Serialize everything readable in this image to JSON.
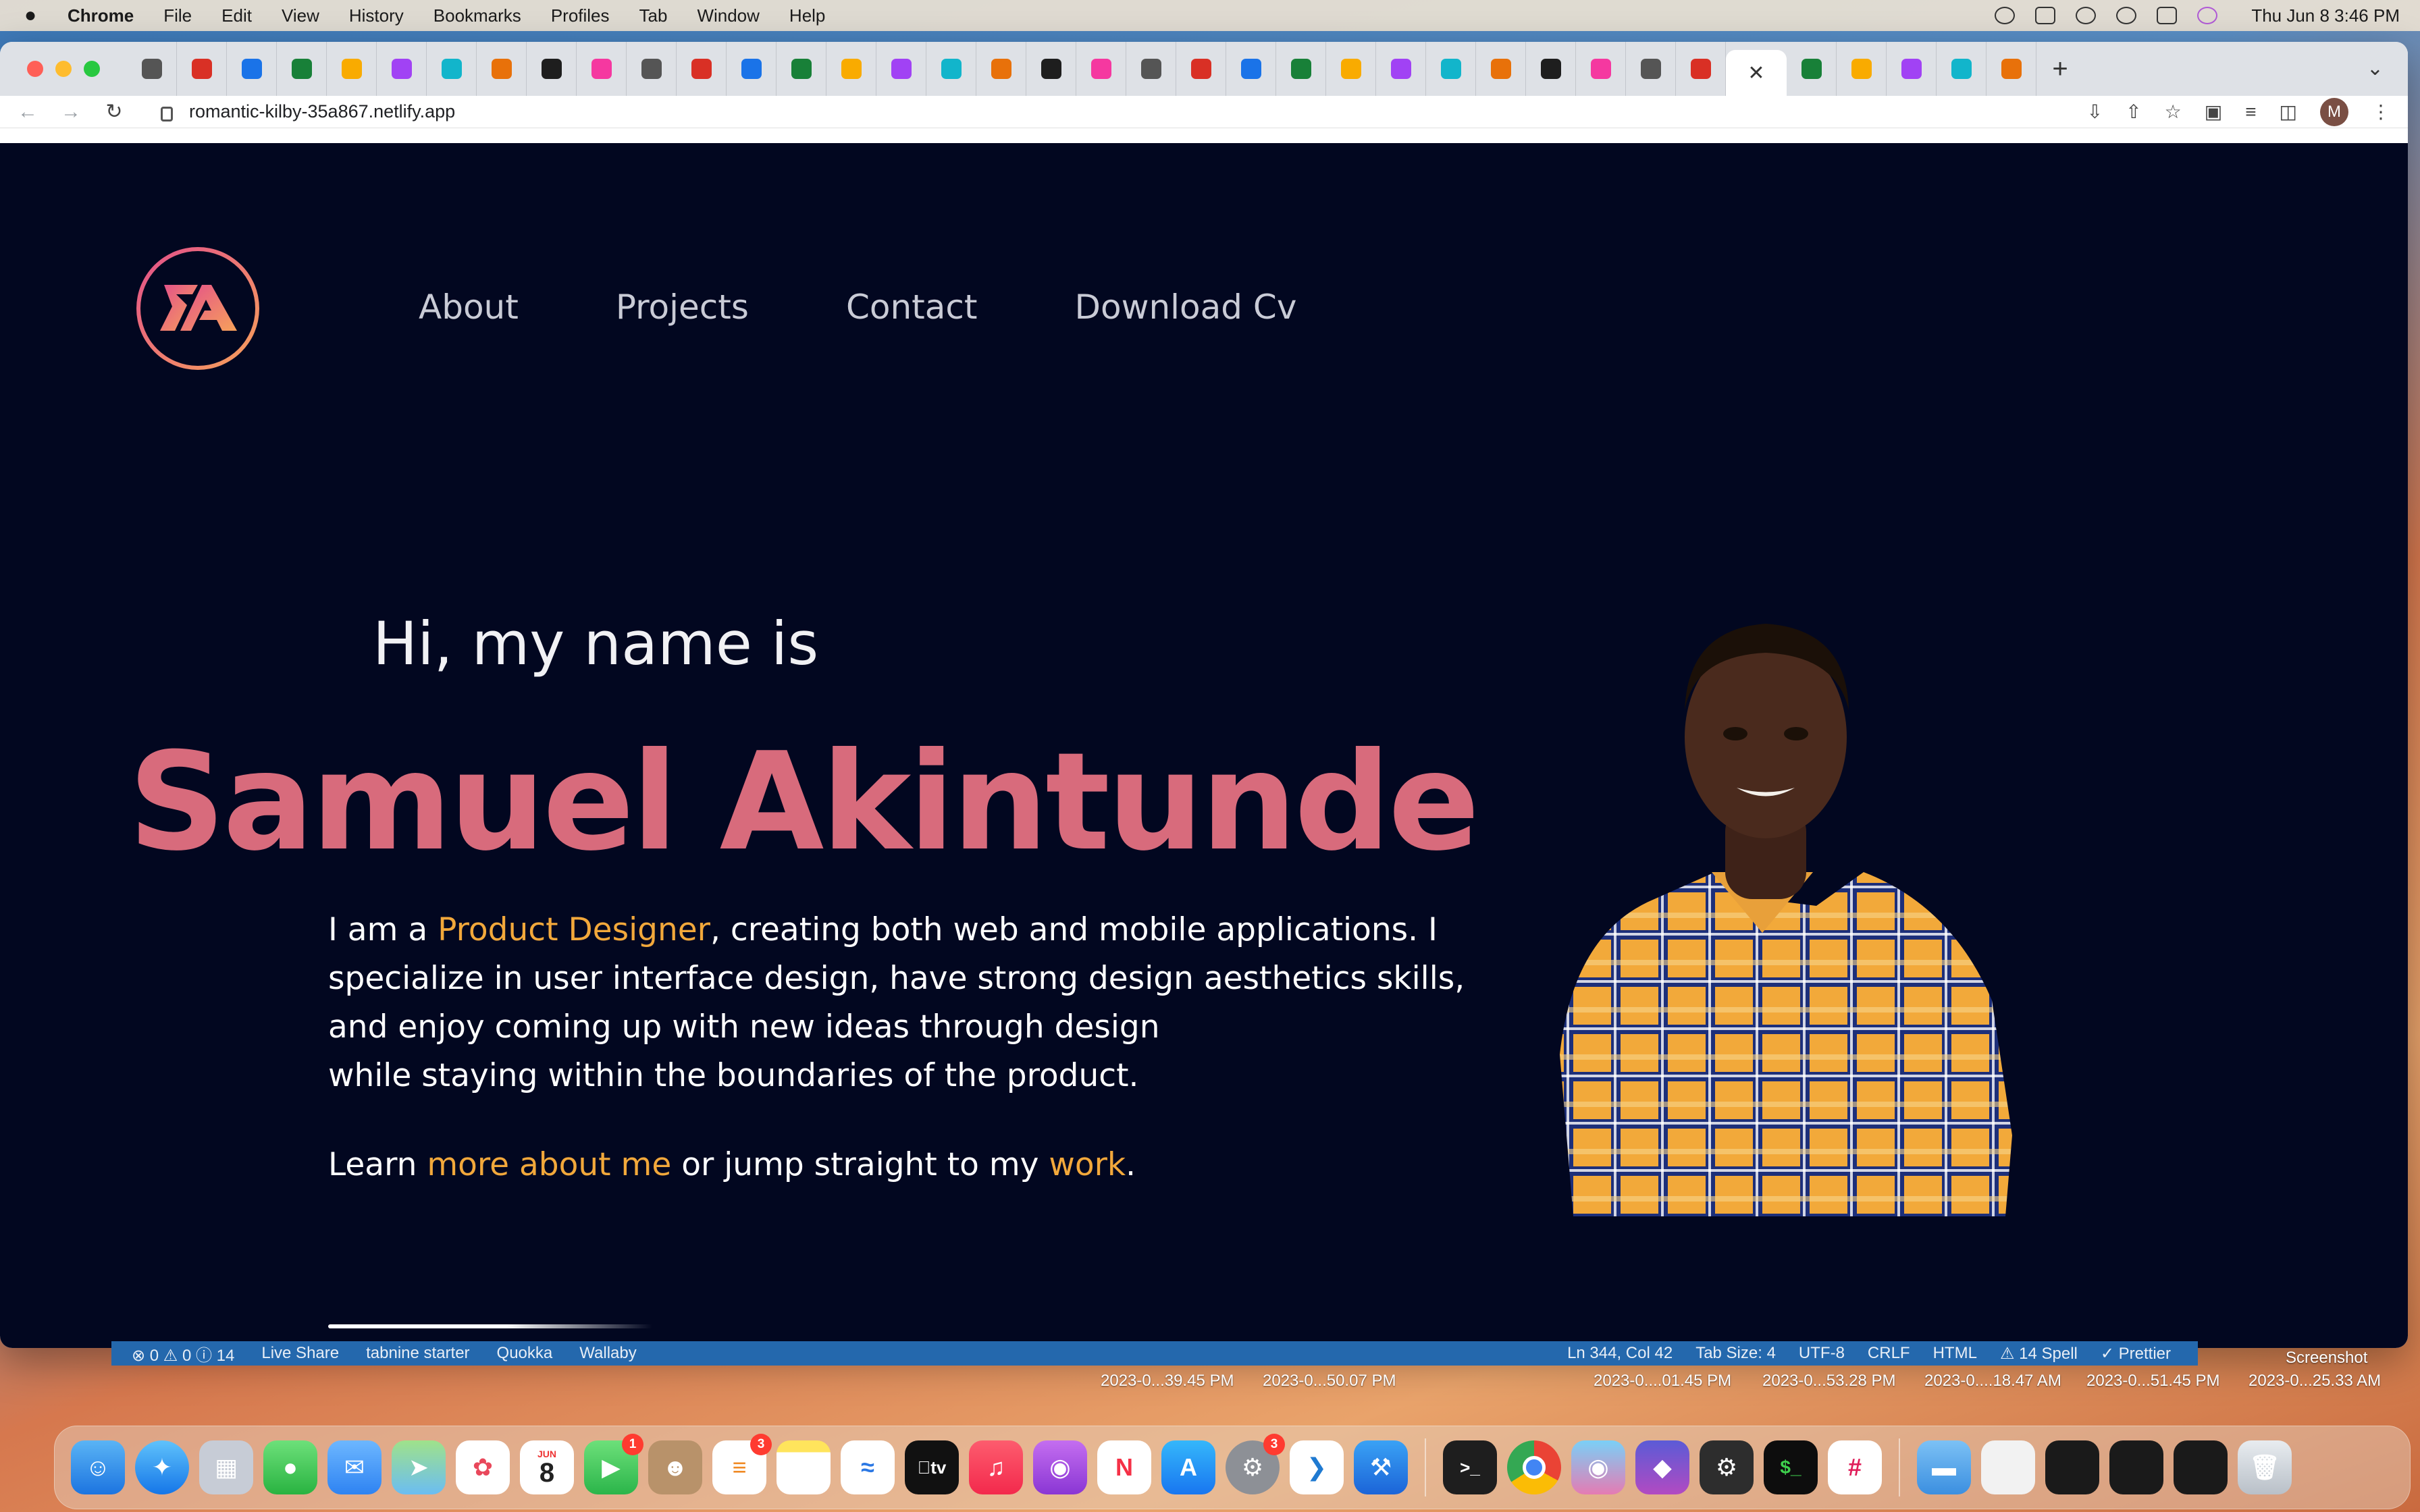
{
  "menubar": {
    "app_name": "Chrome",
    "menus": [
      "File",
      "Edit",
      "View",
      "History",
      "Bookmarks",
      "Profiles",
      "Tab",
      "Window",
      "Help"
    ],
    "clock": "Thu Jun 8  3:46 PM"
  },
  "browser": {
    "url": "romantic-kilby-35a867.netlify.app",
    "profile_initial": "M",
    "tab_count_visible": 37
  },
  "site": {
    "nav": [
      "About",
      "Projects",
      "Contact",
      "Download Cv"
    ],
    "greeting": "Hi, my name is",
    "name": "Samuel Akintunde",
    "bio_prefix": "I am a ",
    "bio_highlight": "Product Designer",
    "bio_rest": ", creating both web and mobile applications. I specialize in user interface design, have strong design aesthetics skills, and enjoy coming up with new ideas through design",
    "bio_line4": "while staying within the boundaries of the product.",
    "learn_prefix": "Learn ",
    "learn_link1": "more about me",
    "learn_middle": " or jump straight to my ",
    "learn_link2": "work",
    "learn_suffix": ".",
    "colors": {
      "background": "#020720",
      "name": "#d86b7c",
      "highlight": "#f2a83b"
    }
  },
  "vscode_status": {
    "problems": "⊗ 0 ⚠ 0 ⓘ 14",
    "live_share": "Live Share",
    "tabnine": "tabnine starter",
    "quokka": "Quokka",
    "wallaby": "Wallaby",
    "position": "Ln 344, Col 42",
    "tab_size": "Tab Size: 4",
    "encoding": "UTF-8",
    "eol": "CRLF",
    "language": "HTML",
    "spell": "⚠ 14 Spell",
    "prettier": "✓ Prettier"
  },
  "desktop_labels": [
    "2023-0...39.45 PM",
    "2023-0...50.07 PM",
    "2023-0....01.45 PM",
    "2023-0...53.28 PM",
    "2023-0....18.47 AM",
    "2023-0...51.45 PM",
    "2023-0...25.33 AM",
    "Screenshot"
  ],
  "dock": {
    "calendar_month": "JUN",
    "calendar_day": "8",
    "facetime_badge": "1",
    "reminders_badge": "3",
    "settings_badge": "3",
    "tv_label": "tv"
  }
}
